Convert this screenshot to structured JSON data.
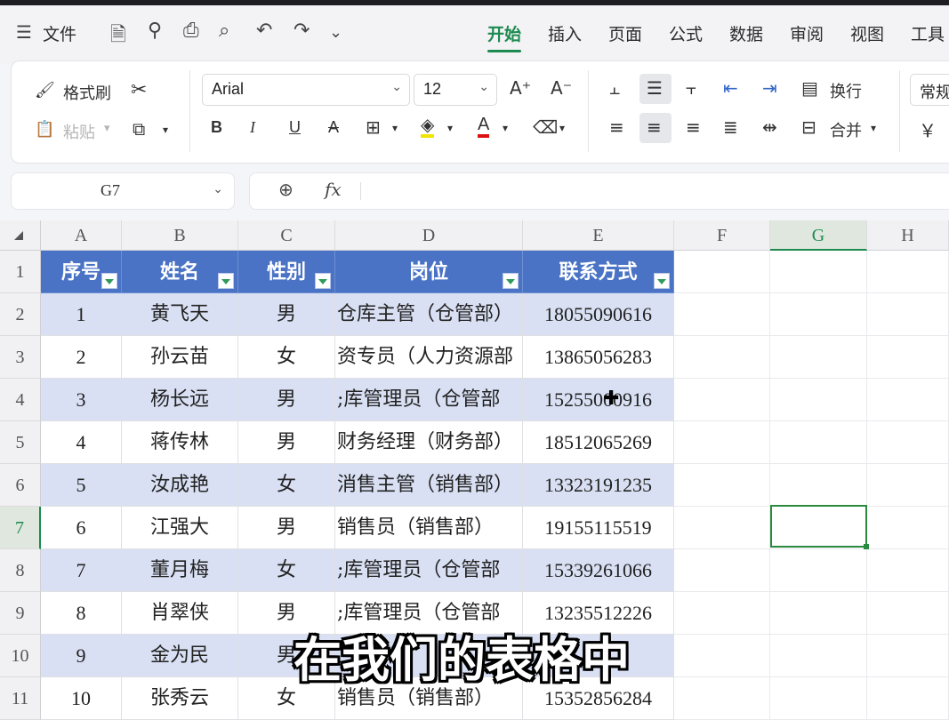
{
  "menu": {
    "file_label": "文件",
    "tabs": [
      "开始",
      "插入",
      "页面",
      "公式",
      "数据",
      "审阅",
      "视图",
      "工具"
    ],
    "active_tab": "开始"
  },
  "ribbon": {
    "format_painter": "格式刷",
    "paste": "粘贴",
    "font_name": "Arial",
    "font_size": "12",
    "wrap": "换行",
    "merge": "合并",
    "number_format": "常规",
    "currency_symbol": "￥",
    "bold": "B",
    "italic": "I",
    "underline": "U",
    "strike": "A",
    "grow_font": "A⁺",
    "shrink_font": "A⁻"
  },
  "formula_bar": {
    "name_box": "G7",
    "fx": "fx",
    "formula": ""
  },
  "columns": [
    "A",
    "B",
    "C",
    "D",
    "E",
    "F",
    "G",
    "H"
  ],
  "selected_column": "G",
  "selected_row": "7",
  "rows": [
    "1",
    "2",
    "3",
    "4",
    "5",
    "6",
    "7",
    "8",
    "9",
    "10",
    "11"
  ],
  "table": {
    "headers": [
      "序号",
      "姓名",
      "性别",
      "岗位",
      "联系方式"
    ],
    "records": [
      [
        "1",
        "黄飞天",
        "男",
        "仓库主管（仓管部）",
        "18055090616"
      ],
      [
        "2",
        "孙云苗",
        "女",
        "资专员（人力资源部",
        "13865056283"
      ],
      [
        "3",
        "杨长远",
        "男",
        ";库管理员（仓管部",
        "15255000916"
      ],
      [
        "4",
        "蒋传林",
        "男",
        "财务经理（财务部）",
        "18512065269"
      ],
      [
        "5",
        "汝成艳",
        "女",
        "消售主管（销售部）",
        "13323191235"
      ],
      [
        "6",
        "江强大",
        "男",
        "销售员（销售部）",
        "19155115519"
      ],
      [
        "7",
        "董月梅",
        "女",
        ";库管理员（仓管部",
        "15339261066"
      ],
      [
        "8",
        "肖翠侠",
        "男",
        ";库管理员（仓管部",
        "13235512226"
      ],
      [
        "9",
        "金为民",
        "男",
        "",
        ""
      ],
      [
        "10",
        "张秀云",
        "女",
        "销售员（销售部）",
        "15352856284"
      ]
    ]
  },
  "subtitle": "在我们的表格中",
  "colors": {
    "header_fill": "#4a73c5",
    "band_fill": "#d9e0f3",
    "active_accent": "#1d8a4f"
  }
}
